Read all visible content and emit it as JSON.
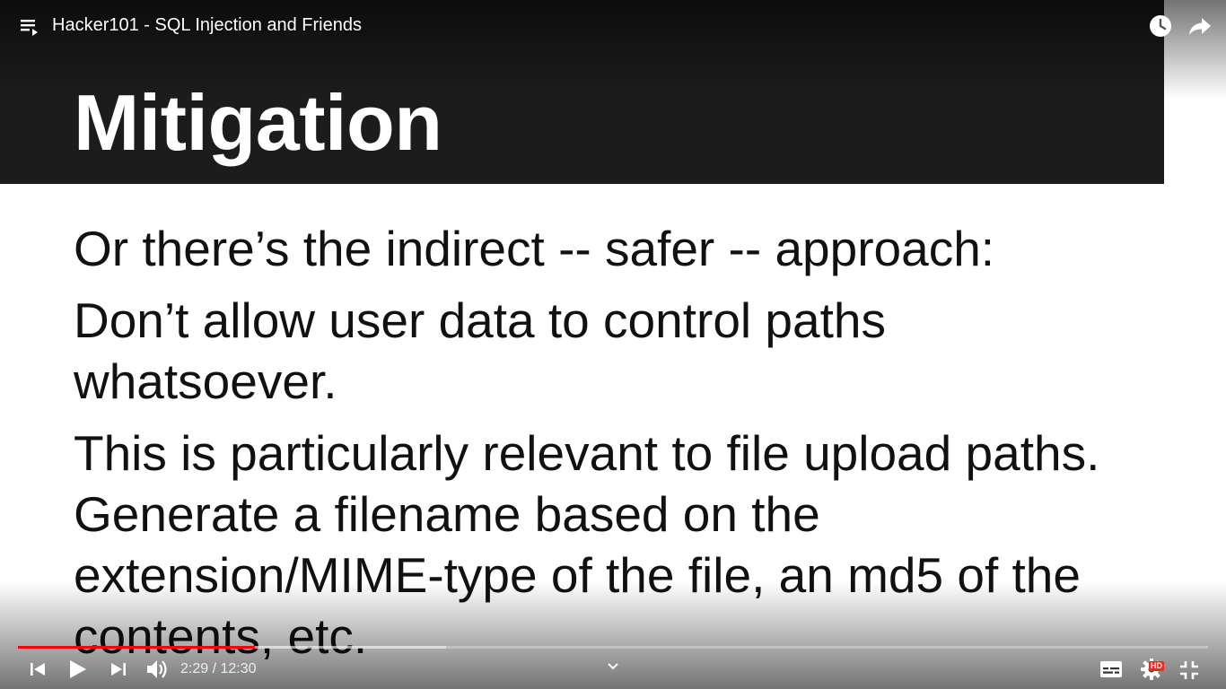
{
  "player": {
    "title": "Hacker101 - SQL Injection and Friends",
    "current_time": "2:29",
    "separator": " / ",
    "duration": "12:30",
    "progress_fraction": 0.199,
    "buffered_fraction": 0.36,
    "hd_badge": "HD",
    "accent_color": "#ff0000",
    "icons": {
      "playlist": "playlist-icon",
      "watch_later": "clock-icon",
      "share": "share-arrow-icon",
      "previous": "skip-previous-icon",
      "play": "play-icon",
      "next": "skip-next-icon",
      "volume": "volume-icon",
      "more": "chevron-down-icon",
      "subtitles": "subtitles-icon",
      "settings": "gear-icon",
      "exit_fullscreen": "exit-fullscreen-icon"
    }
  },
  "slide": {
    "title": "Mitigation",
    "header_color": "#1c1c1d",
    "bullets": [
      [
        "Or there’s the indirect -- safer -- approach:"
      ],
      [
        "Don’t allow user data to control paths",
        "whatsoever."
      ],
      [
        "This is particularly relevant to file upload paths.",
        "Generate a filename based on the",
        "extension/MIME-type of the file, an md5 of the",
        "contents, etc."
      ]
    ]
  }
}
